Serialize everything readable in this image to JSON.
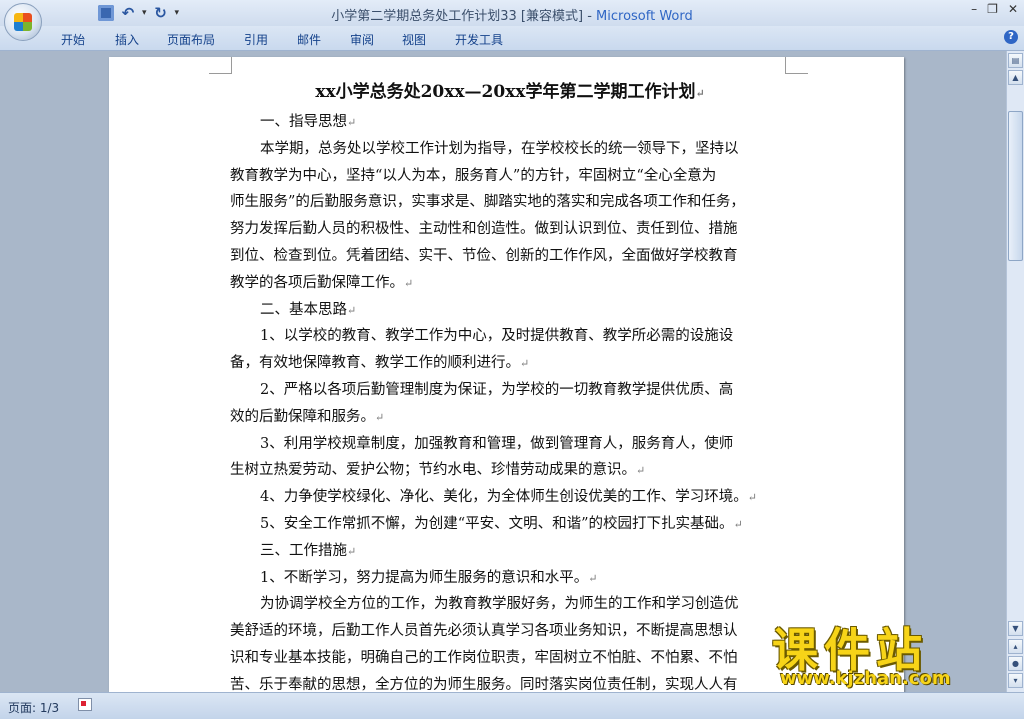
{
  "window": {
    "title": "小学第二学期总务处工作计划33 [兼容模式]",
    "app_name": "Microsoft Word",
    "controls": [
      "–",
      "❐",
      "✕"
    ]
  },
  "quick_access": {
    "save_icon": "save-icon",
    "undo_icon": "undo-icon",
    "redo_icon": "redo-icon"
  },
  "ribbon": {
    "tabs": [
      "开始",
      "插入",
      "页面布局",
      "引用",
      "邮件",
      "审阅",
      "视图",
      "开发工具"
    ],
    "help": "?"
  },
  "document": {
    "title": "xx小学总务处20xx—20xx学年第二学期工作计划",
    "lines": [
      {
        "text": "一、指导思想",
        "style": "h"
      },
      {
        "text": "本学期，总务处以学校工作计划为指导，在学校校长的统一领导下，坚持以",
        "style": "indent"
      },
      {
        "text": "教育教学为中心，坚持“以人为本，服务育人”的方针，牢固树立“全心全意为",
        "style": "plain"
      },
      {
        "text": "师生服务”的后勤服务意识，实事求是、脚踏实地的落实和完成各项工作和任务，",
        "style": "plain"
      },
      {
        "text": "努力发挥后勤人员的积极性、主动性和创造性。做到认识到位、责任到位、措施",
        "style": "plain"
      },
      {
        "text": "到位、检查到位。凭着团结、实干、节俭、创新的工作作风，全面做好学校教育",
        "style": "plain"
      },
      {
        "text": "教学的各项后勤保障工作。",
        "style": "plain"
      },
      {
        "text": "二、基本思路",
        "style": "h"
      },
      {
        "text": "1、以学校的教育、教学工作为中心，及时提供教育、教学所必需的设施设",
        "style": "indent"
      },
      {
        "text": "备，有效地保障教育、教学工作的顺利进行。",
        "style": "plain"
      },
      {
        "text": "2、严格以各项后勤管理制度为保证，为学校的一切教育教学提供优质、高",
        "style": "indent"
      },
      {
        "text": "效的后勤保障和服务。",
        "style": "plain"
      },
      {
        "text": "3、利用学校规章制度，加强教育和管理，做到管理育人，服务育人，使师",
        "style": "indent"
      },
      {
        "text": "生树立热爱劳动、爱护公物；节约水电、珍惜劳动成果的意识。",
        "style": "plain"
      },
      {
        "text": "4、力争使学校绿化、净化、美化，为全体师生创设优美的工作、学习环境。",
        "style": "indent"
      },
      {
        "text": "5、安全工作常抓不懈，为创建“平安、文明、和谐”的校园打下扎实基础。",
        "style": "indent"
      },
      {
        "text": "三、工作措施",
        "style": "h"
      },
      {
        "text": "1、不断学习，努力提高为师生服务的意识和水平。",
        "style": "indent"
      },
      {
        "text": "为协调学校全方位的工作，为教育教学服好务，为师生的工作和学习创造优",
        "style": "indent"
      },
      {
        "text": "美舒适的环境，后勤工作人员首先必须认真学习各项业务知识，不断提高思想认",
        "style": "plain"
      },
      {
        "text": "识和专业基本技能，明确自己的工作岗位职责，牢固树立不怕脏、不怕累、不怕",
        "style": "plain"
      },
      {
        "text": "苦、乐于奉献的思想，全方位的为师生服务。同时落实岗位责任制，实现人人有",
        "style": "plain"
      }
    ],
    "paragraph_mark": "↵"
  },
  "status_bar": {
    "page_count": "页面: 1/3"
  },
  "watermark": {
    "main": "课件站",
    "url": "www.kjzhan.com"
  }
}
